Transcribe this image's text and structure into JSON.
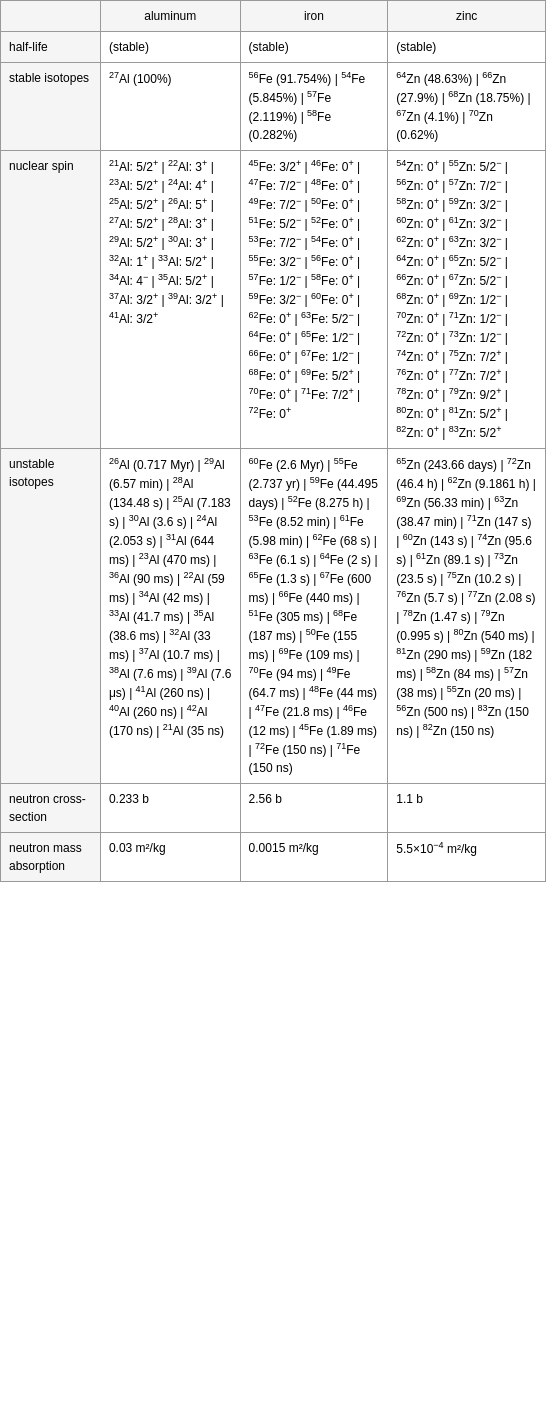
{
  "table": {
    "headers": [
      "",
      "aluminum",
      "iron",
      "zinc"
    ],
    "rows": [
      {
        "label": "half-life",
        "aluminum": "(stable)",
        "iron": "(stable)",
        "zinc": "(stable)"
      },
      {
        "label": "stable isotopes",
        "aluminum_html": "<sup>27</sup>Al (100%)",
        "iron_html": "<sup>56</sup>Fe (91.754%) | <sup>54</sup>Fe (5.845%) | <sup>57</sup>Fe (2.119%) | <sup>58</sup>Fe (0.282%)",
        "zinc_html": "<sup>64</sup>Zn (48.63%) | <sup>66</sup>Zn (27.9%) | <sup>68</sup>Zn (18.75%) | <sup>67</sup>Zn (4.1%) | <sup>70</sup>Zn (0.62%)"
      },
      {
        "label": "nuclear spin",
        "aluminum_html": "<sup>21</sup>Al: 5/2<sup>+</sup> | <sup>22</sup>Al: 3<sup>+</sup> | <sup>23</sup>Al: 5/2<sup>+</sup> | <sup>24</sup>Al: 4<sup>+</sup> | <sup>25</sup>Al: 5/2<sup>+</sup> | <sup>26</sup>Al: 5<sup>+</sup> | <sup>27</sup>Al: 5/2<sup>+</sup> | <sup>28</sup>Al: 3<sup>+</sup> | <sup>29</sup>Al: 5/2<sup>+</sup> | <sup>30</sup>Al: 3<sup>+</sup> | <sup>32</sup>Al: 1<sup>+</sup> | <sup>33</sup>Al: 5/2<sup>+</sup> | <sup>34</sup>Al: 4<sup>−</sup> | <sup>35</sup>Al: 5/2<sup>+</sup> | <sup>37</sup>Al: 3/2<sup>+</sup> | <sup>39</sup>Al: 3/2<sup>+</sup> | <sup>41</sup>Al: 3/2<sup>+</sup>",
        "iron_html": "<sup>45</sup>Fe: 3/2<sup>+</sup> | <sup>46</sup>Fe: 0<sup>+</sup> | <sup>47</sup>Fe: 7/2<sup>−</sup> | <sup>48</sup>Fe: 0<sup>+</sup> | <sup>49</sup>Fe: 7/2<sup>−</sup> | <sup>50</sup>Fe: 0<sup>+</sup> | <sup>51</sup>Fe: 5/2<sup>−</sup> | <sup>52</sup>Fe: 0<sup>+</sup> | <sup>53</sup>Fe: 7/2<sup>−</sup> | <sup>54</sup>Fe: 0<sup>+</sup> | <sup>55</sup>Fe: 3/2<sup>−</sup> | <sup>56</sup>Fe: 0<sup>+</sup> | <sup>57</sup>Fe: 1/2<sup>−</sup> | <sup>58</sup>Fe: 0<sup>+</sup> | <sup>59</sup>Fe: 3/2<sup>−</sup> | <sup>60</sup>Fe: 0<sup>+</sup> | <sup>62</sup>Fe: 0<sup>+</sup> | <sup>63</sup>Fe: 5/2<sup>−</sup> | <sup>64</sup>Fe: 0<sup>+</sup> | <sup>65</sup>Fe: 1/2<sup>−</sup> | <sup>66</sup>Fe: 0<sup>+</sup> | <sup>67</sup>Fe: 1/2<sup>−</sup> | <sup>68</sup>Fe: 0<sup>+</sup> | <sup>69</sup>Fe: 5/2<sup>+</sup> | <sup>70</sup>Fe: 0<sup>+</sup> | <sup>71</sup>Fe: 7/2<sup>+</sup> | <sup>72</sup>Fe: 0<sup>+</sup>",
        "zinc_html": "<sup>54</sup>Zn: 0<sup>+</sup> | <sup>55</sup>Zn: 5/2<sup>−</sup> | <sup>56</sup>Zn: 0<sup>+</sup> | <sup>57</sup>Zn: 7/2<sup>−</sup> | <sup>58</sup>Zn: 0<sup>+</sup> | <sup>59</sup>Zn: 3/2<sup>−</sup> | <sup>60</sup>Zn: 0<sup>+</sup> | <sup>61</sup>Zn: 3/2<sup>−</sup> | <sup>62</sup>Zn: 0<sup>+</sup> | <sup>63</sup>Zn: 3/2<sup>−</sup> | <sup>64</sup>Zn: 0<sup>+</sup> | <sup>65</sup>Zn: 5/2<sup>−</sup> | <sup>66</sup>Zn: 0<sup>+</sup> | <sup>67</sup>Zn: 5/2<sup>−</sup> | <sup>68</sup>Zn: 0<sup>+</sup> | <sup>69</sup>Zn: 1/2<sup>−</sup> | <sup>70</sup>Zn: 0<sup>+</sup> | <sup>71</sup>Zn: 1/2<sup>−</sup> | <sup>72</sup>Zn: 0<sup>+</sup> | <sup>73</sup>Zn: 1/2<sup>−</sup> | <sup>74</sup>Zn: 0<sup>+</sup> | <sup>75</sup>Zn: 7/2<sup>+</sup> | <sup>76</sup>Zn: 0<sup>+</sup> | <sup>77</sup>Zn: 7/2<sup>+</sup> | <sup>78</sup>Zn: 0<sup>+</sup> | <sup>79</sup>Zn: 9/2<sup>+</sup> | <sup>80</sup>Zn: 0<sup>+</sup> | <sup>81</sup>Zn: 5/2<sup>+</sup> | <sup>82</sup>Zn: 0<sup>+</sup> | <sup>83</sup>Zn: 5/2<sup>+</sup>"
      },
      {
        "label": "unstable isotopes",
        "aluminum_html": "<sup>26</sup>Al (0.717 Myr) | <sup>29</sup>Al (6.57 min) | <sup>28</sup>Al (134.48 s) | <sup>25</sup>Al (7.183 s) | <sup>30</sup>Al (3.6 s) | <sup>24</sup>Al (2.053 s) | <sup>31</sup>Al (644 ms) | <sup>23</sup>Al (470 ms) | <sup>36</sup>Al (90 ms) | <sup>22</sup>Al (59 ms) | <sup>34</sup>Al (42 ms) | <sup>33</sup>Al (41.7 ms) | <sup>35</sup>Al (38.6 ms) | <sup>32</sup>Al (33 ms) | <sup>37</sup>Al (10.7 ms) | <sup>38</sup>Al (7.6 ms) | <sup>39</sup>Al (7.6 μs) | <sup>41</sup>Al (260 ns) | <sup>40</sup>Al (260 ns) | <sup>42</sup>Al (170 ns) | <sup>21</sup>Al (35 ns)",
        "iron_html": "<sup>60</sup>Fe (2.6 Myr) | <sup>55</sup>Fe (2.737 yr) | <sup>59</sup>Fe (44.495 days) | <sup>52</sup>Fe (8.275 h) | <sup>53</sup>Fe (8.52 min) | <sup>61</sup>Fe (5.98 min) | <sup>62</sup>Fe (68 s) | <sup>63</sup>Fe (6.1 s) | <sup>64</sup>Fe (2 s) | <sup>65</sup>Fe (1.3 s) | <sup>67</sup>Fe (600 ms) | <sup>66</sup>Fe (440 ms) | <sup>51</sup>Fe (305 ms) | <sup>68</sup>Fe (187 ms) | <sup>50</sup>Fe (155 ms) | <sup>69</sup>Fe (109 ms) | <sup>70</sup>Fe (94 ms) | <sup>49</sup>Fe (64.7 ms) | <sup>48</sup>Fe (44 ms) | <sup>47</sup>Fe (21.8 ms) | <sup>46</sup>Fe (12 ms) | <sup>45</sup>Fe (1.89 ms) | <sup>72</sup>Fe (150 ns) | <sup>71</sup>Fe (150 ns)",
        "zinc_html": "<sup>65</sup>Zn (243.66 days) | <sup>72</sup>Zn (46.4 h) | <sup>62</sup>Zn (9.1861 h) | <sup>69</sup>Zn (56.33 min) | <sup>63</sup>Zn (38.47 min) | <sup>71</sup>Zn (147 s) | <sup>60</sup>Zn (143 s) | <sup>74</sup>Zn (95.6 s) | <sup>61</sup>Zn (89.1 s) | <sup>73</sup>Zn (23.5 s) | <sup>75</sup>Zn (10.2 s) | <sup>76</sup>Zn (5.7 s) | <sup>77</sup>Zn (2.08 s) | <sup>78</sup>Zn (1.47 s) | <sup>79</sup>Zn (0.995 s) | <sup>80</sup>Zn (540 ms) | <sup>81</sup>Zn (290 ms) | <sup>59</sup>Zn (182 ms) | <sup>58</sup>Zn (84 ms) | <sup>57</sup>Zn (38 ms) | <sup>55</sup>Zn (20 ms) | <sup>56</sup>Zn (500 ns) | <sup>83</sup>Zn (150 ns) | <sup>82</sup>Zn (150 ns)"
      },
      {
        "label": "neutron cross-section",
        "aluminum": "0.233 b",
        "iron": "2.56 b",
        "zinc": "1.1 b"
      },
      {
        "label": "neutron mass absorption",
        "aluminum": "0.03 m²/kg",
        "iron": "0.0015 m²/kg",
        "zinc": "5.5×10⁻⁴ m²/kg"
      }
    ]
  }
}
